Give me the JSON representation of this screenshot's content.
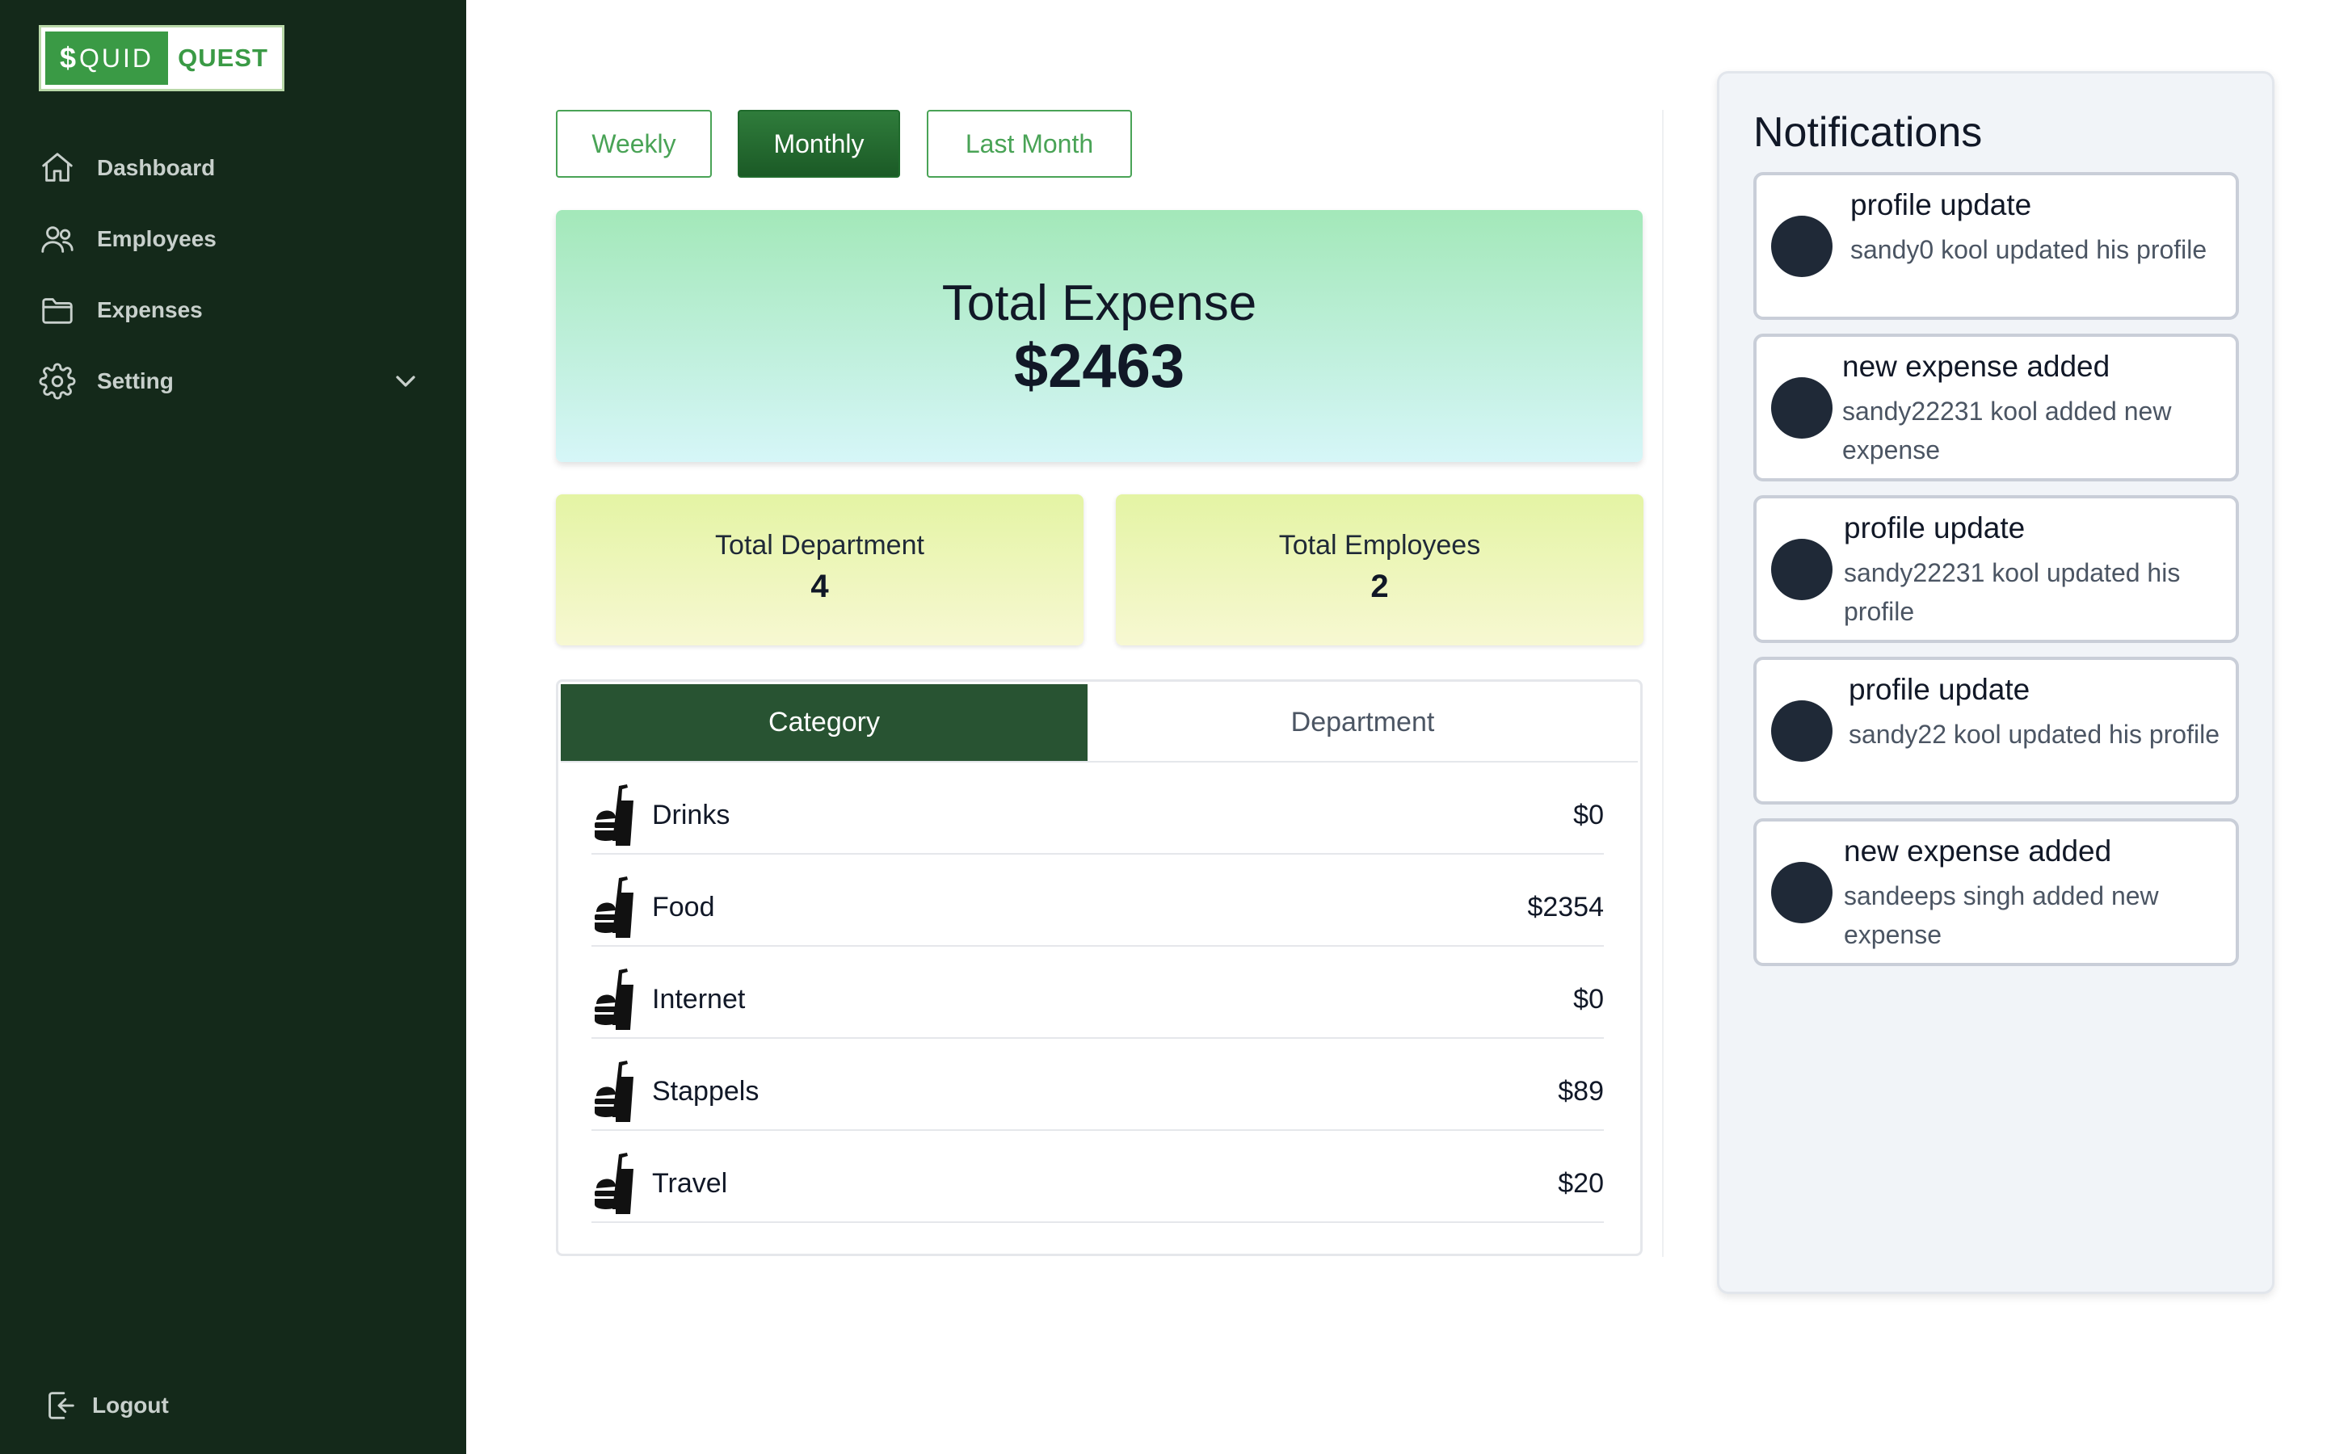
{
  "brand": {
    "symbol": "$",
    "part1": "QUID",
    "part2": "QUEST"
  },
  "sidebar": {
    "items": [
      {
        "label": "Dashboard",
        "icon": "home-icon"
      },
      {
        "label": "Employees",
        "icon": "users-icon"
      },
      {
        "label": "Expenses",
        "icon": "folder-icon"
      },
      {
        "label": "Setting",
        "icon": "gear-icon"
      }
    ],
    "logout_label": "Logout"
  },
  "period_filters": [
    {
      "label": "Weekly",
      "active": false
    },
    {
      "label": "Monthly",
      "active": true
    },
    {
      "label": "Last Month",
      "active": false
    }
  ],
  "summary": {
    "total_expense_label": "Total Expense",
    "total_expense_value": "$2463",
    "total_department_label": "Total Department",
    "total_department_value": "4",
    "total_employees_label": "Total Employees",
    "total_employees_value": "2"
  },
  "breakdown": {
    "tabs": [
      {
        "label": "Category",
        "active": true
      },
      {
        "label": "Department",
        "active": false
      }
    ],
    "rows": [
      {
        "name": "Drinks",
        "amount": "$0",
        "icon": "fast-food-icon"
      },
      {
        "name": "Food",
        "amount": "$2354",
        "icon": "fast-food-icon"
      },
      {
        "name": "Internet",
        "amount": "$0",
        "icon": "fast-food-icon"
      },
      {
        "name": "Stappels",
        "amount": "$89",
        "icon": "fast-food-icon"
      },
      {
        "name": "Travel",
        "amount": "$20",
        "icon": "fast-food-icon"
      }
    ]
  },
  "notifications": {
    "title": "Notifications",
    "items": [
      {
        "title": "profile update",
        "message": "sandy0 kool updated his profile"
      },
      {
        "title": "new expense added",
        "message": "sandy22231 kool added new expense"
      },
      {
        "title": "profile update",
        "message": "sandy22231 kool updated his profile"
      },
      {
        "title": "profile update",
        "message": "sandy22 kool updated his profile"
      },
      {
        "title": "new expense added",
        "message": "sandeeps singh added new expense"
      }
    ]
  },
  "colors": {
    "sidebar_bg": "#14291a",
    "brand_green": "#3a9a45",
    "active_tab": "#285332",
    "notif_dot": "#1f2937"
  }
}
